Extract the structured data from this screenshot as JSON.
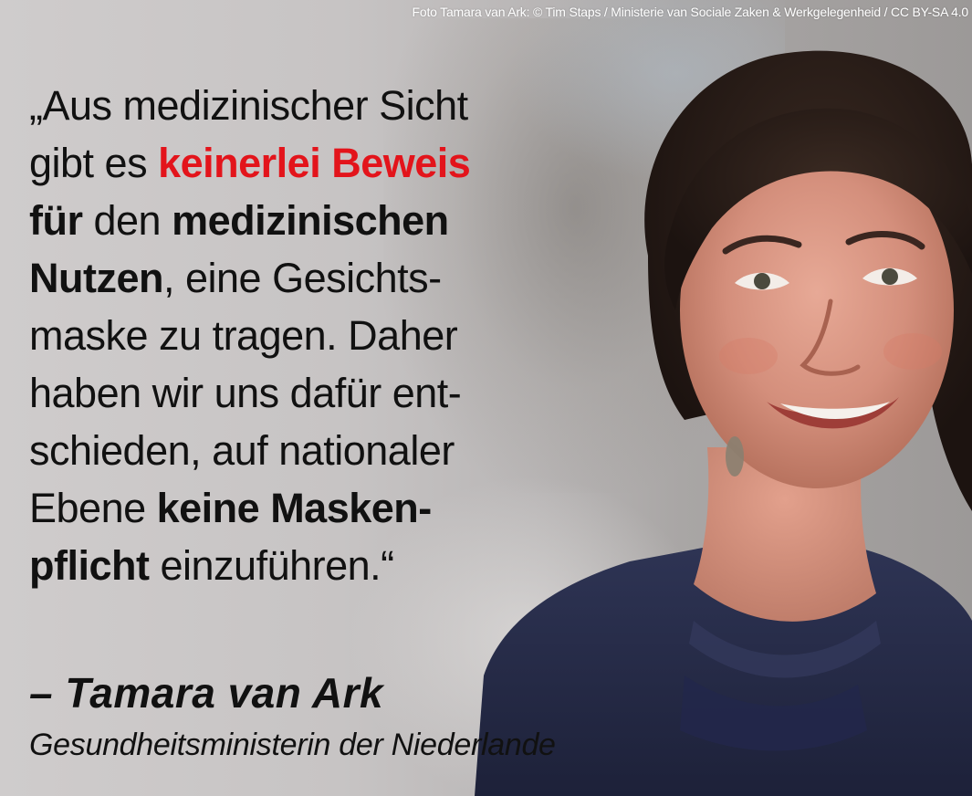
{
  "credit": "Foto Tamara van Ark: © Tim Staps / Ministerie van Sociale Zaken & Werkgelegenheid / CC BY-SA 4.0",
  "quote": {
    "l1": {
      "a": "„Aus medizinischer Sicht"
    },
    "l2": {
      "a": "gibt es ",
      "red": "keinerlei Beweis"
    },
    "l3": {
      "b1": "für",
      "a": " den ",
      "b2": "medizinischen"
    },
    "l4": {
      "b": "Nutzen",
      "a": ", eine Gesichts-"
    },
    "l5": {
      "a": "maske zu tragen. Daher"
    },
    "l6": {
      "a": "haben wir uns dafür ent-"
    },
    "l7": {
      "a": "schieden, auf nationaler"
    },
    "l8": {
      "a": "Ebene ",
      "b": "keine Masken-"
    },
    "l9": {
      "b": "pflicht",
      "a": " einzuführen.“"
    }
  },
  "author": "– Tamara van Ark",
  "role": "Gesundheitsministerin der Niederlande",
  "colors": {
    "highlight": "#e3141b",
    "text": "#111111",
    "background": "#c9c6c6",
    "blouse": "#262b48"
  },
  "portrait_description_icon": "portrait-photo"
}
